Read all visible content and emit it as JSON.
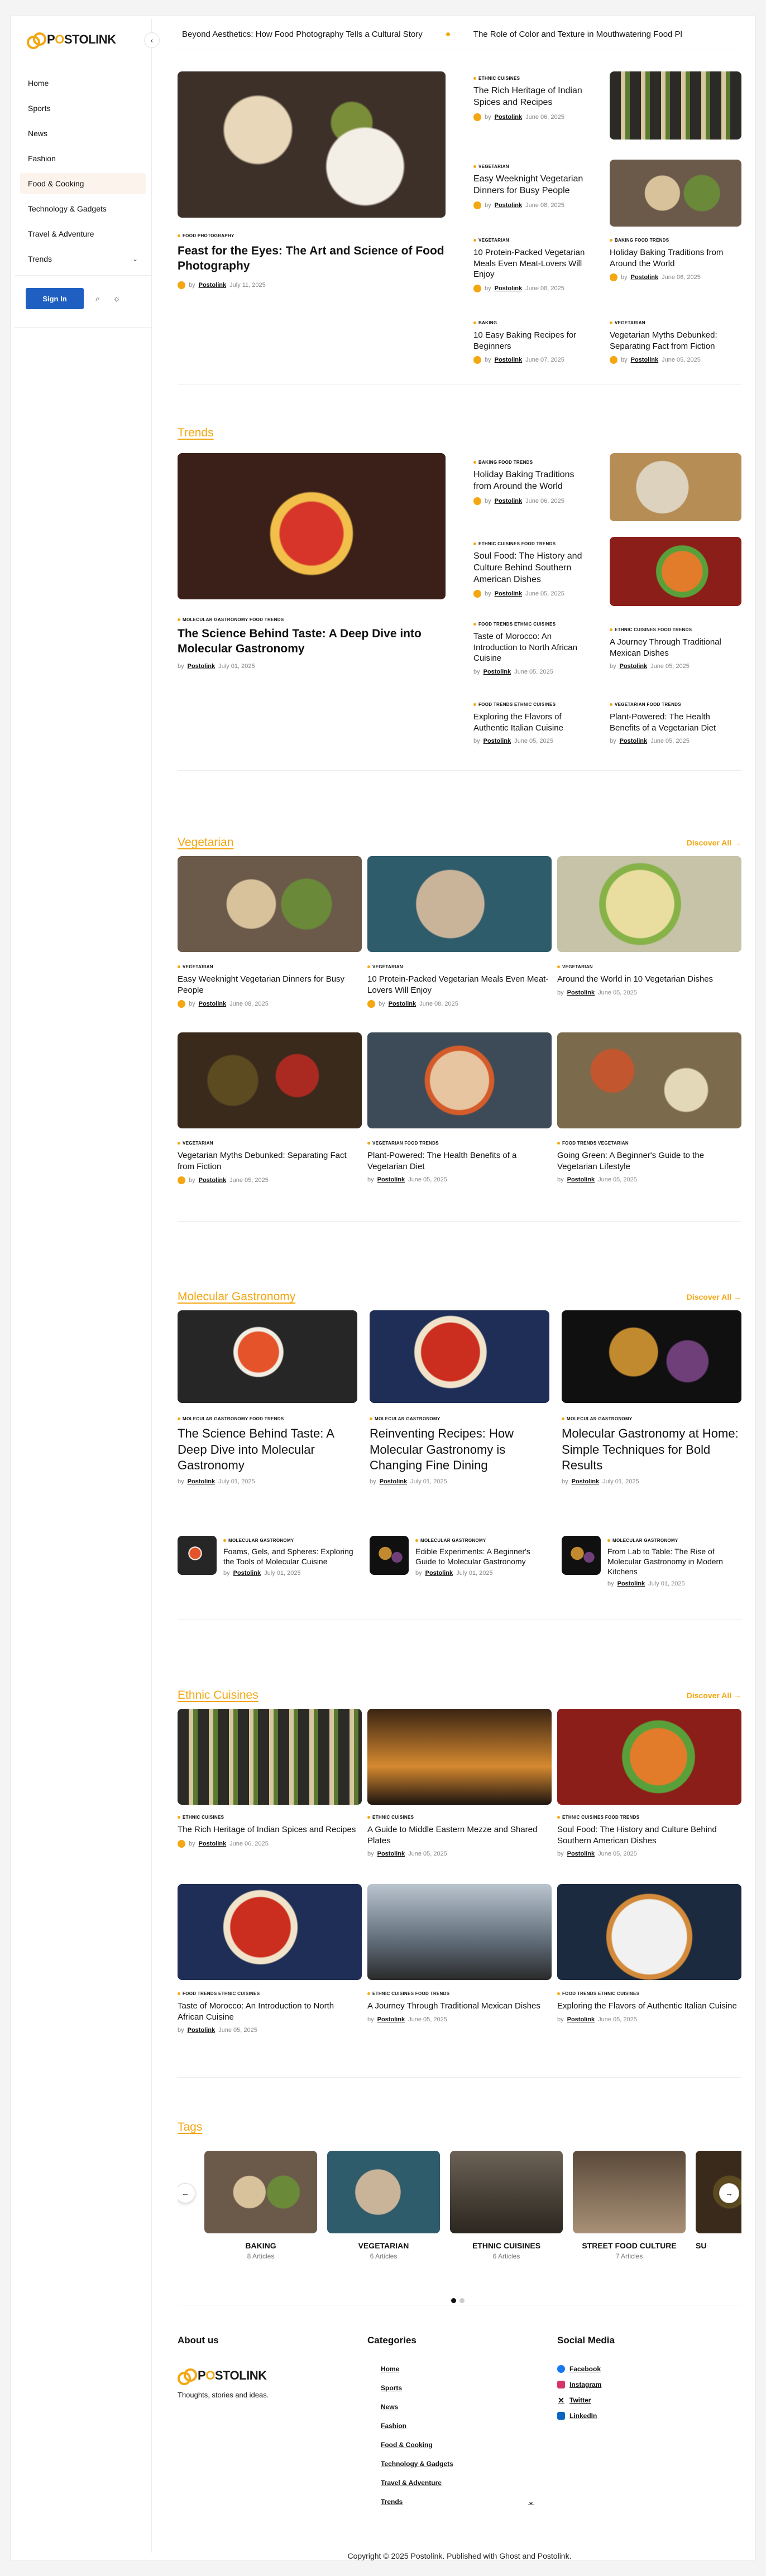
{
  "brand": {
    "name_pre": "P",
    "name_o": "O",
    "name_post": "STOLINK",
    "tagline": "Thoughts, stories and ideas.",
    "accent": "#f3a712"
  },
  "sidebar": {
    "items": [
      {
        "label": "Home"
      },
      {
        "label": "Sports"
      },
      {
        "label": "News"
      },
      {
        "label": "Fashion"
      },
      {
        "label": "Food & Cooking"
      },
      {
        "label": "Technology & Gadgets"
      },
      {
        "label": "Travel & Adventure"
      },
      {
        "label": "Trends"
      }
    ],
    "signin": "Sign In"
  },
  "ticker": [
    "Beyond Aesthetics: How Food Photography Tells a Cultural Story",
    "The Role of Color and Texture in Mouthwatering Food Pl"
  ],
  "featured": {
    "main": {
      "cat": "Food Photography",
      "title": "Feast for the Eyes: The Art and Science of Food Photography",
      "by": "by",
      "author": "Postolink",
      "date": "July 11, 2025"
    },
    "posts": [
      {
        "cat": "Ethnic Cuisines",
        "title": "The Rich Heritage of Indian Spices and Recipes",
        "author": "Postolink",
        "date": "June 06, 2025"
      },
      {
        "cat": "Vegetarian",
        "title": "Easy Weeknight Vegetarian Dinners for Busy People",
        "author": "Postolink",
        "date": "June 08, 2025"
      },
      {
        "cat": "Vegetarian",
        "title": "10 Protein-Packed Vegetarian Meals Even Meat-Lovers Will Enjoy",
        "author": "Postolink",
        "date": "June 08, 2025"
      },
      {
        "cat": "Baking  Food Trends",
        "title": "Holiday Baking Traditions from Around the World",
        "author": "Postolink",
        "date": "June 06, 2025"
      },
      {
        "cat": "Baking",
        "title": "10 Easy Baking Recipes for Beginners",
        "author": "Postolink",
        "date": "June 07, 2025"
      },
      {
        "cat": "Vegetarian",
        "title": "Vegetarian Myths Debunked: Separating Fact from Fiction",
        "author": "Postolink",
        "date": "June 05, 2025"
      }
    ]
  },
  "trends": {
    "heading": "Trends",
    "main": {
      "cat": "Molecular Gastronomy  Food Trends",
      "title": "The Science Behind Taste: A Deep Dive into Molecular Gastronomy",
      "author": "Postolink",
      "date": "July 01, 2025"
    },
    "posts": [
      {
        "cat": "Baking  Food Trends",
        "title": "Holiday Baking Traditions from Around the World",
        "author": "Postolink",
        "date": "June 06, 2025"
      },
      {
        "cat": "Ethnic Cuisines  Food Trends",
        "title": "Soul Food: The History and Culture Behind Southern American Dishes",
        "author": "Postolink",
        "date": "June 05, 2025"
      },
      {
        "cat": "Food Trends  Ethnic Cuisines",
        "title": "Taste of Morocco: An Introduction to North African Cuisine",
        "author": "Postolink",
        "date": "June 05, 2025"
      },
      {
        "cat": "Ethnic Cuisines  Food Trends",
        "title": "A Journey Through Traditional Mexican Dishes",
        "author": "Postolink",
        "date": "June 05, 2025"
      },
      {
        "cat": "Food Trends  Ethnic Cuisines",
        "title": "Exploring the Flavors of Authentic Italian Cuisine",
        "author": "Postolink",
        "date": "June 05, 2025"
      },
      {
        "cat": "Vegetarian  Food Trends",
        "title": "Plant-Powered: The Health Benefits of a Vegetarian Diet",
        "author": "Postolink",
        "date": "June 05, 2025"
      }
    ]
  },
  "vegetarian": {
    "heading": "Vegetarian",
    "discover": "Discover All →",
    "posts": [
      {
        "cat": "Vegetarian",
        "title": "Easy Weeknight Vegetarian Dinners for Busy People",
        "author": "Postolink",
        "date": "June 08, 2025"
      },
      {
        "cat": "Vegetarian",
        "title": "10 Protein-Packed Vegetarian Meals Even Meat-Lovers Will Enjoy",
        "author": "Postolink",
        "date": "June 08, 2025"
      },
      {
        "cat": "Vegetarian",
        "title": "Around the World in 10 Vegetarian Dishes",
        "author": "Postolink",
        "date": "June 05, 2025"
      },
      {
        "cat": "Vegetarian",
        "title": "Vegetarian Myths Debunked: Separating Fact from Fiction",
        "author": "Postolink",
        "date": "June 05, 2025"
      },
      {
        "cat": "Vegetarian  Food Trends",
        "title": "Plant-Powered: The Health Benefits of a Vegetarian Diet",
        "author": "Postolink",
        "date": "June 05, 2025"
      },
      {
        "cat": "Food Trends  Vegetarian",
        "title": "Going Green: A Beginner's Guide to the Vegetarian Lifestyle",
        "author": "Postolink",
        "date": "June 05, 2025"
      }
    ]
  },
  "molecular": {
    "heading": "Molecular Gastronomy",
    "discover": "Discover All →",
    "posts": [
      {
        "cat": "Molecular Gastronomy  Food Trends",
        "title": "The Science Behind Taste: A Deep Dive into Molecular Gastronomy",
        "author": "Postolink",
        "date": "July 01, 2025"
      },
      {
        "cat": "Molecular Gastronomy",
        "title": "Reinventing Recipes: How Molecular Gastronomy is Changing Fine Dining",
        "author": "Postolink",
        "date": "July 01, 2025"
      },
      {
        "cat": "Molecular Gastronomy",
        "title": "Molecular Gastronomy at Home: Simple Techniques for Bold Results",
        "author": "Postolink",
        "date": "July 01, 2025"
      }
    ],
    "small": [
      {
        "cat": "Molecular Gastronomy",
        "title": "Foams, Gels, and Spheres: Exploring the Tools of Molecular Cuisine",
        "author": "Postolink",
        "date": "July 01, 2025"
      },
      {
        "cat": "Molecular Gastronomy",
        "title": "Edible Experiments: A Beginner's Guide to Molecular Gastronomy",
        "author": "Postolink",
        "date": "July 01, 2025"
      },
      {
        "cat": "Molecular Gastronomy",
        "title": "From Lab to Table: The Rise of Molecular Gastronomy in Modern Kitchens",
        "author": "Postolink",
        "date": "July 01, 2025"
      }
    ]
  },
  "ethnic": {
    "heading": "Ethnic Cuisines",
    "discover": "Discover All →",
    "posts": [
      {
        "cat": "Ethnic Cuisines",
        "title": "The Rich Heritage of Indian Spices and Recipes",
        "author": "Postolink",
        "date": "June 06, 2025"
      },
      {
        "cat": "Ethnic Cuisines",
        "title": "A Guide to Middle Eastern Mezze and Shared Plates",
        "author": "Postolink",
        "date": "June 05, 2025"
      },
      {
        "cat": "Ethnic Cuisines  Food Trends",
        "title": "Soul Food: The History and Culture Behind Southern American Dishes",
        "author": "Postolink",
        "date": "June 05, 2025"
      },
      {
        "cat": "Food Trends  Ethnic Cuisines",
        "title": "Taste of Morocco: An Introduction to North African Cuisine",
        "author": "Postolink",
        "date": "June 05, 2025"
      },
      {
        "cat": "Ethnic Cuisines  Food Trends",
        "title": "A Journey Through Traditional Mexican Dishes",
        "author": "Postolink",
        "date": "June 05, 2025"
      },
      {
        "cat": "Food Trends  Ethnic Cuisines",
        "title": "Exploring the Flavors of Authentic Italian Cuisine",
        "author": "Postolink",
        "date": "June 05, 2025"
      }
    ]
  },
  "tags": {
    "heading": "Tags",
    "items": [
      {
        "name": "BAKING",
        "count": "8 Articles"
      },
      {
        "name": "VEGETARIAN",
        "count": "6 Articles"
      },
      {
        "name": "ETHNIC CUISINES",
        "count": "6 Articles"
      },
      {
        "name": "STREET FOOD CULTURE",
        "count": "7 Articles"
      },
      {
        "name": "SU",
        "count": ""
      }
    ]
  },
  "footer": {
    "about": "About us",
    "categories": "Categories",
    "social": "Social Media",
    "cat_links": [
      "Home",
      "Sports",
      "News",
      "Fashion",
      "Food & Cooking",
      "Technology & Gadgets",
      "Travel & Adventure",
      "Trends"
    ],
    "social_links": [
      {
        "label": "Facebook",
        "color": "#1877f2"
      },
      {
        "label": "Instagram",
        "color": "#d6336c"
      },
      {
        "label": "Twitter",
        "color": "#111111"
      },
      {
        "label": "LinkedIn",
        "color": "#0a66c2"
      }
    ]
  },
  "copyright": "Copyright © 2025 Postolink. Published with Ghost and Postolink."
}
